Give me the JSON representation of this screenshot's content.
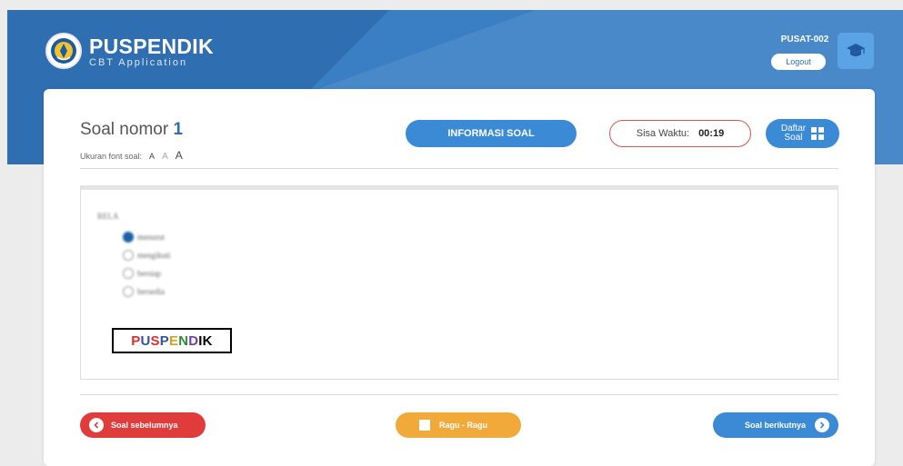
{
  "header": {
    "brand_title": "PUSPENDIK",
    "brand_subtitle": "CBT Application",
    "user_id": "PUSAT-002",
    "logout_label": "Logout"
  },
  "question_panel": {
    "title_prefix": "Soal nomor",
    "question_number": "1",
    "font_size_label": "Ukuran font soal:",
    "font_size_options": [
      "A",
      "A",
      "A"
    ],
    "info_button_label": "INFORMASI SOAL",
    "timer_label": "Sisa Waktu:",
    "timer_value": "00:19",
    "daftar_label_line1": "Daftar",
    "daftar_label_line2": "Soal"
  },
  "question": {
    "stem": "RELA",
    "options": [
      {
        "text": "menurut",
        "selected": true
      },
      {
        "text": "mengikuti",
        "selected": false
      },
      {
        "text": "bersiap",
        "selected": false
      },
      {
        "text": "bersedia",
        "selected": false
      }
    ],
    "logo_letters": [
      "P",
      "U",
      "S",
      "P",
      "E",
      "N",
      "D",
      "I",
      "K"
    ]
  },
  "navigation": {
    "prev_label": "Soal sebelumnya",
    "ragu_label": "Ragu - Ragu",
    "next_label": "Soal berikutnya"
  },
  "colors": {
    "primary_blue": "#3a8ad6",
    "header_blue": "#3a7fc4",
    "prev_red": "#e03c3c",
    "ragu_orange": "#f1a93a"
  }
}
